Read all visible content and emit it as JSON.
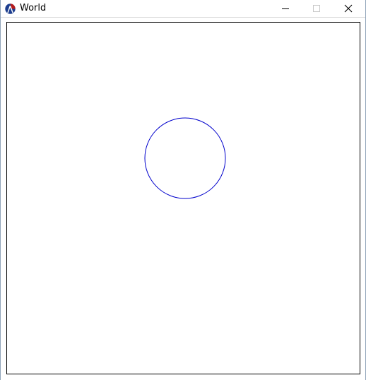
{
  "window": {
    "title": "World",
    "icon": "racket-logo-icon",
    "controls": {
      "minimize": "minimize-icon",
      "maximize": "maximize-icon",
      "close": "close-icon"
    }
  },
  "canvas": {
    "background": "#ffffff",
    "border_color": "#000000",
    "shapes": [
      {
        "type": "circle",
        "style": "outline",
        "color": "#0000cc"
      }
    ]
  }
}
